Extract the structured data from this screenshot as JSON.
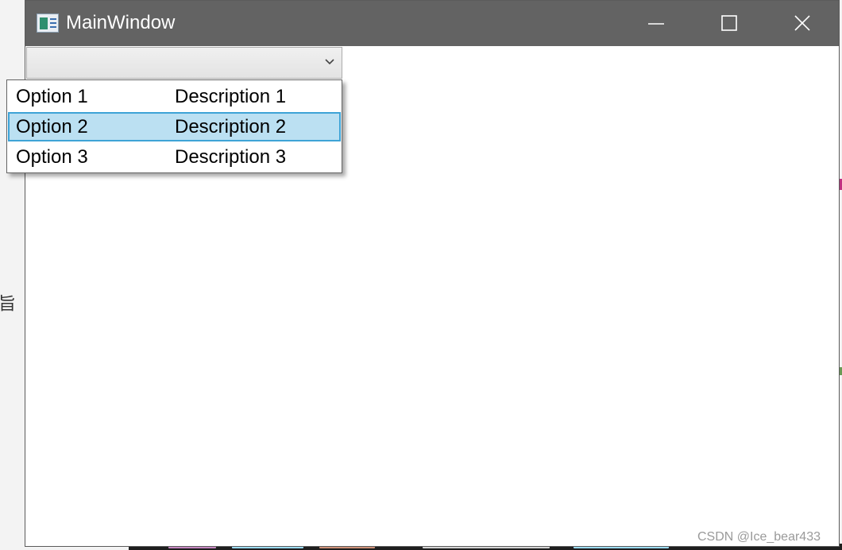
{
  "background": {
    "side_char": "旨"
  },
  "window": {
    "title": "MainWindow",
    "icon": "app-window-icon",
    "controls": {
      "minimize_icon": "minimize-icon",
      "maximize_icon": "maximize-icon",
      "close_icon": "close-icon"
    }
  },
  "combobox": {
    "selected_value": "",
    "arrow_icon": "chevron-down-icon"
  },
  "dropdown": {
    "items": [
      {
        "option": "Option 1",
        "description": "Description 1",
        "highlighted": false
      },
      {
        "option": "Option 2",
        "description": "Description 2",
        "highlighted": true
      },
      {
        "option": "Option 3",
        "description": "Description 3",
        "highlighted": false
      }
    ]
  },
  "watermark": "CSDN @Ice_bear433",
  "colors": {
    "titlebar": "#636363",
    "highlight_fill": "#bbe0f2",
    "highlight_border": "#3ea3d6"
  }
}
